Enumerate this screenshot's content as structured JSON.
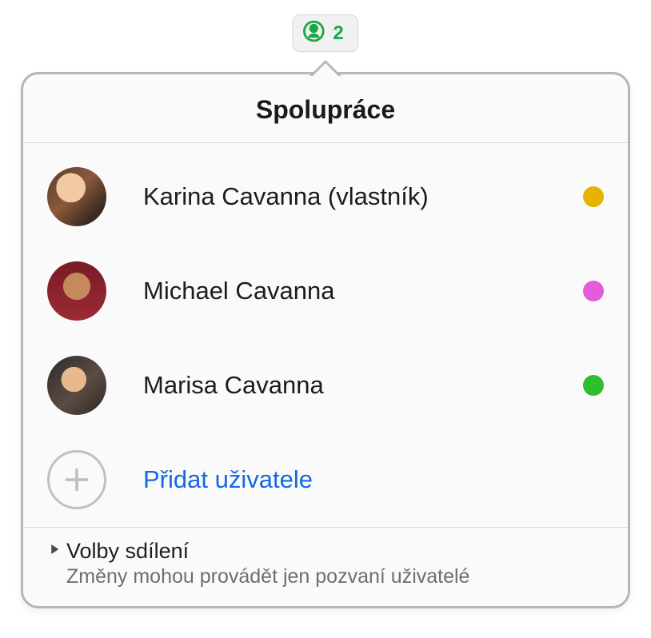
{
  "toolbar": {
    "count": "2",
    "icon_color": "#1aa744"
  },
  "popover": {
    "title": "Spolupráce",
    "people": [
      {
        "name": "Karina Cavanna (vlastník)",
        "dot_color": "#e6b400"
      },
      {
        "name": "Michael Cavanna",
        "dot_color": "#e65bdc"
      },
      {
        "name": "Marisa Cavanna",
        "dot_color": "#2fbe2f"
      }
    ],
    "add_label": "Přidat uživatele",
    "share": {
      "title": "Volby sdílení",
      "subtitle": "Změny mohou provádět jen pozvaní uživatelé"
    }
  }
}
